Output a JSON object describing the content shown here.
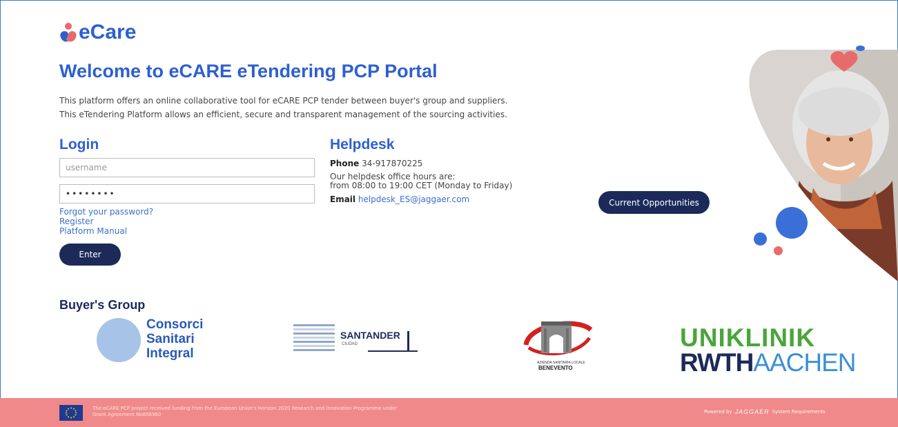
{
  "brand": {
    "name": "eCare",
    "primary_color": "#2d5fd1",
    "accent_color": "#e86b6b",
    "button_color": "#1c2a5a",
    "footer_color": "#f08a8a"
  },
  "welcome": {
    "title": "Welcome to eCARE eTendering PCP Portal",
    "line1": "This platform offers an online collaborative tool for eCARE PCP tender between buyer's group and suppliers.",
    "line2": "This eTendering Platform allows an efficient, secure and transparent management of the sourcing activities."
  },
  "login": {
    "title": "Login",
    "username_placeholder": "username",
    "password_value": "password",
    "forgot_label": "Forgot your password?",
    "register_label": "Register",
    "manual_label": "Platform Manual",
    "enter_label": "Enter"
  },
  "helpdesk": {
    "title": "Helpdesk",
    "phone_label": "Phone",
    "phone_value": "34-917870225",
    "hours_line1": "Our helpdesk office hours are:",
    "hours_line2": "from 08:00 to 19:00 CET (Monday to Friday)",
    "email_label": "Email",
    "email_value": "helpdesk_ES@jaggaer.com"
  },
  "opportunities_label": "Current Opportunities",
  "buyers": {
    "title": "Buyer's Group",
    "consorci": [
      "Consorci",
      "Sanitari",
      "Integral"
    ],
    "santander": {
      "name": "SANTANDER",
      "sub": "CIUDAD"
    },
    "benevento": {
      "small": "AZIENDA SANITARIA LOCALE",
      "big": "BENEVENTO"
    },
    "uniklinik": {
      "line1": "UNIKLINIK",
      "line2_bold": "RWTH",
      "line2_light": "AACHEN"
    }
  },
  "footer": {
    "funding_line1": "The eCARE PCP project received funding from the European Union's Horizon 2020 Research and Innovation Programme under",
    "funding_line2": "Grant Agreement No856960",
    "powered_by": "Powered by",
    "jaggaer": "JAGGAER",
    "system_requirements": "System Requirements"
  }
}
